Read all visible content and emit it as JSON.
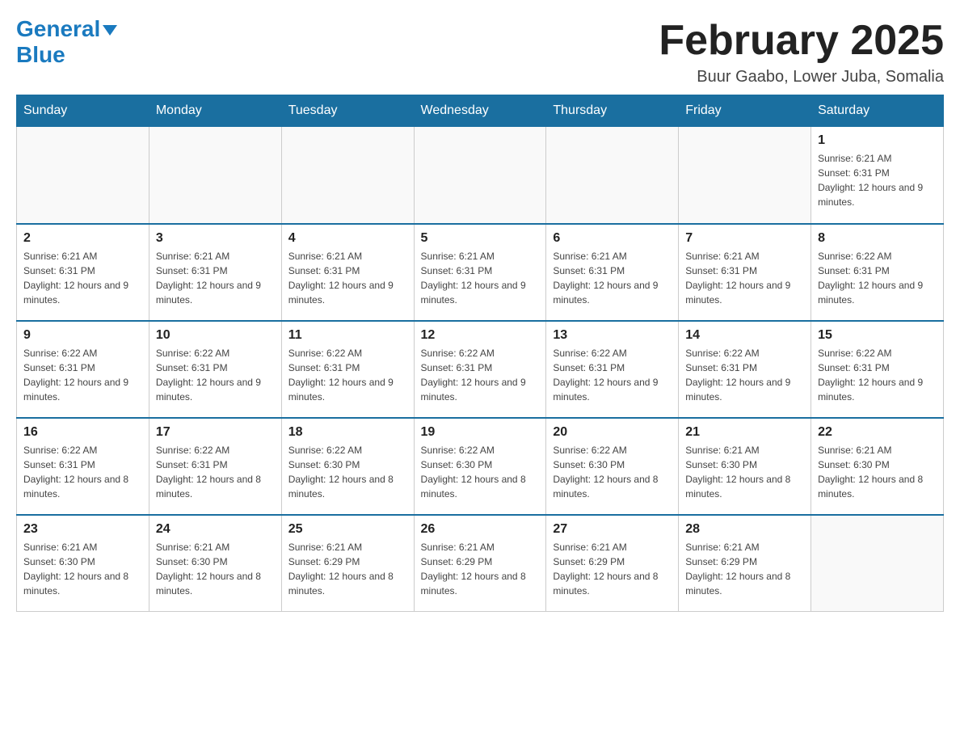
{
  "logo": {
    "general": "General",
    "blue": "Blue",
    "arrow": "▼"
  },
  "title": "February 2025",
  "subtitle": "Buur Gaabo, Lower Juba, Somalia",
  "days_of_week": [
    "Sunday",
    "Monday",
    "Tuesday",
    "Wednesday",
    "Thursday",
    "Friday",
    "Saturday"
  ],
  "weeks": [
    [
      {
        "day": "",
        "info": ""
      },
      {
        "day": "",
        "info": ""
      },
      {
        "day": "",
        "info": ""
      },
      {
        "day": "",
        "info": ""
      },
      {
        "day": "",
        "info": ""
      },
      {
        "day": "",
        "info": ""
      },
      {
        "day": "1",
        "info": "Sunrise: 6:21 AM\nSunset: 6:31 PM\nDaylight: 12 hours and 9 minutes."
      }
    ],
    [
      {
        "day": "2",
        "info": "Sunrise: 6:21 AM\nSunset: 6:31 PM\nDaylight: 12 hours and 9 minutes."
      },
      {
        "day": "3",
        "info": "Sunrise: 6:21 AM\nSunset: 6:31 PM\nDaylight: 12 hours and 9 minutes."
      },
      {
        "day": "4",
        "info": "Sunrise: 6:21 AM\nSunset: 6:31 PM\nDaylight: 12 hours and 9 minutes."
      },
      {
        "day": "5",
        "info": "Sunrise: 6:21 AM\nSunset: 6:31 PM\nDaylight: 12 hours and 9 minutes."
      },
      {
        "day": "6",
        "info": "Sunrise: 6:21 AM\nSunset: 6:31 PM\nDaylight: 12 hours and 9 minutes."
      },
      {
        "day": "7",
        "info": "Sunrise: 6:21 AM\nSunset: 6:31 PM\nDaylight: 12 hours and 9 minutes."
      },
      {
        "day": "8",
        "info": "Sunrise: 6:22 AM\nSunset: 6:31 PM\nDaylight: 12 hours and 9 minutes."
      }
    ],
    [
      {
        "day": "9",
        "info": "Sunrise: 6:22 AM\nSunset: 6:31 PM\nDaylight: 12 hours and 9 minutes."
      },
      {
        "day": "10",
        "info": "Sunrise: 6:22 AM\nSunset: 6:31 PM\nDaylight: 12 hours and 9 minutes."
      },
      {
        "day": "11",
        "info": "Sunrise: 6:22 AM\nSunset: 6:31 PM\nDaylight: 12 hours and 9 minutes."
      },
      {
        "day": "12",
        "info": "Sunrise: 6:22 AM\nSunset: 6:31 PM\nDaylight: 12 hours and 9 minutes."
      },
      {
        "day": "13",
        "info": "Sunrise: 6:22 AM\nSunset: 6:31 PM\nDaylight: 12 hours and 9 minutes."
      },
      {
        "day": "14",
        "info": "Sunrise: 6:22 AM\nSunset: 6:31 PM\nDaylight: 12 hours and 9 minutes."
      },
      {
        "day": "15",
        "info": "Sunrise: 6:22 AM\nSunset: 6:31 PM\nDaylight: 12 hours and 9 minutes."
      }
    ],
    [
      {
        "day": "16",
        "info": "Sunrise: 6:22 AM\nSunset: 6:31 PM\nDaylight: 12 hours and 8 minutes."
      },
      {
        "day": "17",
        "info": "Sunrise: 6:22 AM\nSunset: 6:31 PM\nDaylight: 12 hours and 8 minutes."
      },
      {
        "day": "18",
        "info": "Sunrise: 6:22 AM\nSunset: 6:30 PM\nDaylight: 12 hours and 8 minutes."
      },
      {
        "day": "19",
        "info": "Sunrise: 6:22 AM\nSunset: 6:30 PM\nDaylight: 12 hours and 8 minutes."
      },
      {
        "day": "20",
        "info": "Sunrise: 6:22 AM\nSunset: 6:30 PM\nDaylight: 12 hours and 8 minutes."
      },
      {
        "day": "21",
        "info": "Sunrise: 6:21 AM\nSunset: 6:30 PM\nDaylight: 12 hours and 8 minutes."
      },
      {
        "day": "22",
        "info": "Sunrise: 6:21 AM\nSunset: 6:30 PM\nDaylight: 12 hours and 8 minutes."
      }
    ],
    [
      {
        "day": "23",
        "info": "Sunrise: 6:21 AM\nSunset: 6:30 PM\nDaylight: 12 hours and 8 minutes."
      },
      {
        "day": "24",
        "info": "Sunrise: 6:21 AM\nSunset: 6:30 PM\nDaylight: 12 hours and 8 minutes."
      },
      {
        "day": "25",
        "info": "Sunrise: 6:21 AM\nSunset: 6:29 PM\nDaylight: 12 hours and 8 minutes."
      },
      {
        "day": "26",
        "info": "Sunrise: 6:21 AM\nSunset: 6:29 PM\nDaylight: 12 hours and 8 minutes."
      },
      {
        "day": "27",
        "info": "Sunrise: 6:21 AM\nSunset: 6:29 PM\nDaylight: 12 hours and 8 minutes."
      },
      {
        "day": "28",
        "info": "Sunrise: 6:21 AM\nSunset: 6:29 PM\nDaylight: 12 hours and 8 minutes."
      },
      {
        "day": "",
        "info": ""
      }
    ]
  ]
}
